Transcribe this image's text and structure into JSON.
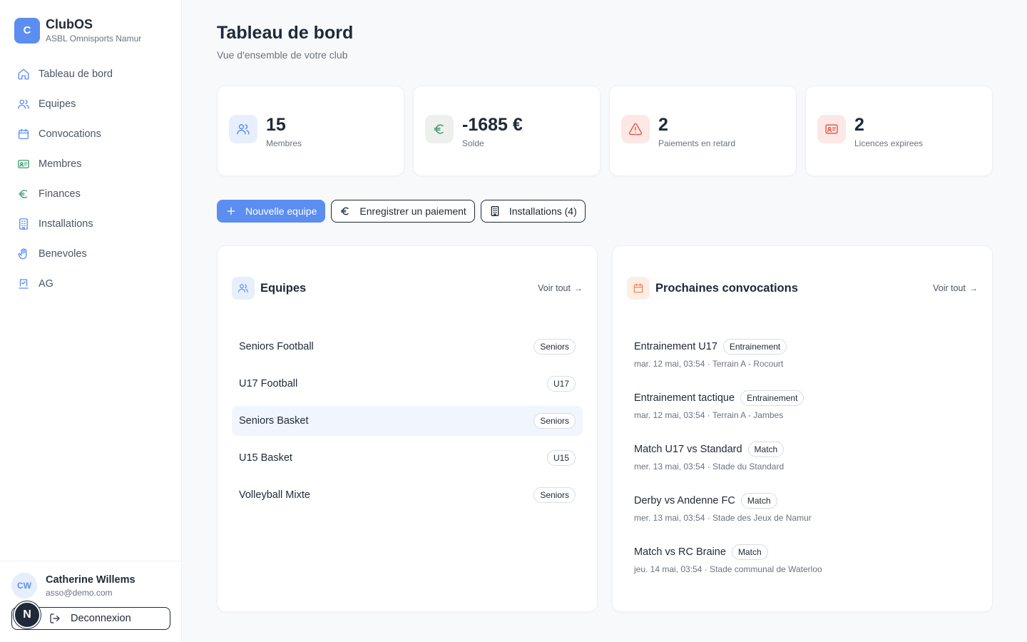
{
  "brand": {
    "logo_letter": "C",
    "name": "ClubOS",
    "subtitle": "ASBL Omnisports Namur"
  },
  "nav": [
    {
      "label": "Tableau de bord",
      "icon": "home-icon"
    },
    {
      "label": "Equipes",
      "icon": "users-icon"
    },
    {
      "label": "Convocations",
      "icon": "calendar-icon"
    },
    {
      "label": "Membres",
      "icon": "id-card-icon"
    },
    {
      "label": "Finances",
      "icon": "euro-icon"
    },
    {
      "label": "Installations",
      "icon": "building-icon"
    },
    {
      "label": "Benevoles",
      "icon": "hand-icon"
    },
    {
      "label": "AG",
      "icon": "vote-icon"
    }
  ],
  "user": {
    "initials": "CW",
    "name": "Catherine Willems",
    "email": "asso@demo.com",
    "logout_label": "Deconnexion",
    "badge": "N"
  },
  "page": {
    "title": "Tableau de bord",
    "subtitle": "Vue d'ensemble de votre club"
  },
  "stats": [
    {
      "value": "15",
      "label": "Membres",
      "icon": "users-icon",
      "color": "#5b8ef0",
      "bg": "#e8effc"
    },
    {
      "value": "-1685 €",
      "label": "Solde",
      "icon": "euro-icon",
      "color": "#3b9a6e",
      "bg": "#eef0ee"
    },
    {
      "value": "2",
      "label": "Paiements en retard",
      "icon": "warning-icon",
      "color": "#e0604f",
      "bg": "#fde8e5"
    },
    {
      "value": "2",
      "label": "Licences expirees",
      "icon": "id-card-icon",
      "color": "#e0604f",
      "bg": "#fde8e5"
    }
  ],
  "actions": {
    "new_team": "Nouvelle equipe",
    "record_payment": "Enregistrer un paiement",
    "facilities": "Installations (4)"
  },
  "teams": {
    "title": "Equipes",
    "see_all": "Voir tout",
    "items": [
      {
        "name": "Seniors Football",
        "category": "Seniors"
      },
      {
        "name": "U17 Football",
        "category": "U17"
      },
      {
        "name": "Seniors Basket",
        "category": "Seniors"
      },
      {
        "name": "U15 Basket",
        "category": "U15"
      },
      {
        "name": "Volleyball Mixte",
        "category": "Seniors"
      }
    ]
  },
  "convocations": {
    "title": "Prochaines convocations",
    "see_all": "Voir tout",
    "items": [
      {
        "title": "Entrainement U17",
        "type": "Entrainement",
        "meta": "mar. 12 mai, 03:54 · Terrain A - Rocourt"
      },
      {
        "title": "Entrainement tactique",
        "type": "Entrainement",
        "meta": "mar. 12 mai, 03:54 · Terrain A - Jambes"
      },
      {
        "title": "Match U17 vs Standard",
        "type": "Match",
        "meta": "mer. 13 mai, 03:54 · Stade du Standard"
      },
      {
        "title": "Derby vs Andenne FC",
        "type": "Match",
        "meta": "mer. 13 mai, 03:54 · Stade des Jeux de Namur"
      },
      {
        "title": "Match vs RC Braine",
        "type": "Match",
        "meta": "jeu. 14 mai, 03:54 · Stade communal de Waterloo"
      }
    ]
  }
}
